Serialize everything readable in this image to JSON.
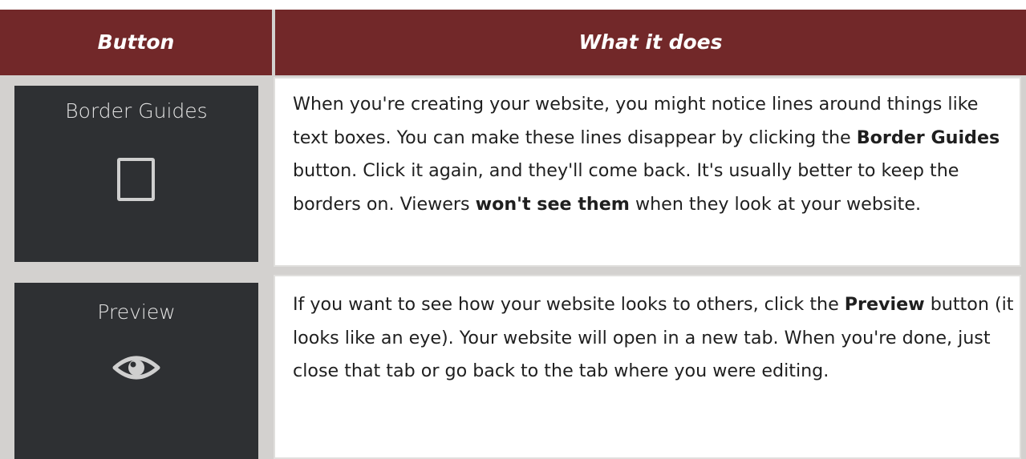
{
  "header": {
    "col_button": "Button",
    "col_what": "What it does"
  },
  "colors": {
    "header_bg": "#722829",
    "button_cell_bg": "#2e3033",
    "grid": "#d3d1cf"
  },
  "rows": [
    {
      "button_label": "Border Guides",
      "icon": "square-outline-icon",
      "desc_1": "When you're creating your website, you might notice lines around things like text boxes. You can make these lines disappear by clicking the ",
      "desc_bold_1": "Border Guides",
      "desc_2": " button. Click it again, and they'll come back. It's usually better to keep the borders on. Viewers ",
      "desc_bold_2": "won't see them",
      "desc_3": " when they look at your website."
    },
    {
      "button_label": "Preview",
      "icon": "eye-icon",
      "desc_1": "If you want to see how your website looks to others, click the ",
      "desc_bold_1": "Preview",
      "desc_2": " button (it looks like an eye). Your website will open in a new tab. When you're done, just close that tab or go back to the tab where you were editing."
    }
  ]
}
